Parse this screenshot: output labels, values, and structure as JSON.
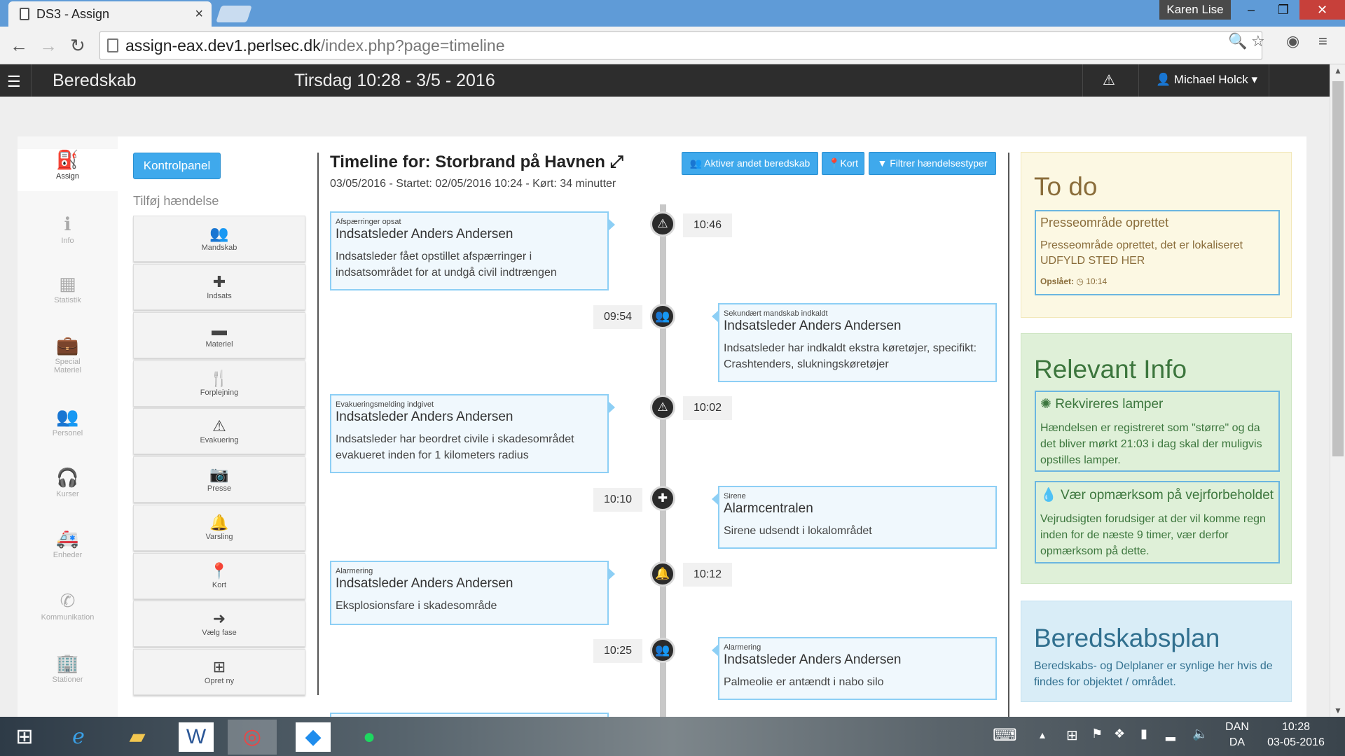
{
  "browser": {
    "tab_title": "DS3 - Assign",
    "tab_close": "×",
    "profile_name": "Karen Lise",
    "url_host": "assign-eax.dev1.perlsec.dk",
    "url_path": "/index.php?page=timeline",
    "win_min": "–",
    "win_max": "❐",
    "win_close": "✕"
  },
  "header": {
    "brand": "Beredskab",
    "datetime": "Tirsdag 10:28 - 3/5 - 2016",
    "user": "Michael Holck"
  },
  "leftnav": [
    {
      "icon": "fire-extinguisher-icon",
      "glyph": "⛽",
      "label": "Assign"
    },
    {
      "icon": "info-icon",
      "glyph": "ℹ",
      "label": "Info"
    },
    {
      "icon": "calendar-icon",
      "glyph": "▦",
      "label": "Statistik"
    },
    {
      "icon": "briefcase-icon",
      "glyph": "💼",
      "label": "Special\nMateriel"
    },
    {
      "icon": "users-icon",
      "glyph": "👥",
      "label": "Personel"
    },
    {
      "icon": "headphones-icon",
      "glyph": "🎧",
      "label": "Kurser"
    },
    {
      "icon": "ambulance-icon",
      "glyph": "🚑",
      "label": "Enheder"
    },
    {
      "icon": "phone-icon",
      "glyph": "✆",
      "label": "Kommunikation"
    },
    {
      "icon": "building-icon",
      "glyph": "🏢",
      "label": "Stationer"
    }
  ],
  "sidebar": {
    "kontrol_label": "Kontrolpanel",
    "add_event_label": "Tilføj hændelse",
    "buttons": [
      {
        "icon": "users-icon",
        "glyph": "👥",
        "label": "Mandskab"
      },
      {
        "icon": "medkit-icon",
        "glyph": "✚",
        "label": "Indsats"
      },
      {
        "icon": "archive-icon",
        "glyph": "▬",
        "label": "Materiel"
      },
      {
        "icon": "cutlery-icon",
        "glyph": "🍴",
        "label": "Forplejning"
      },
      {
        "icon": "warning-icon",
        "glyph": "⚠",
        "label": "Evakuering"
      },
      {
        "icon": "camera-icon",
        "glyph": "📷",
        "label": "Presse"
      },
      {
        "icon": "bell-icon",
        "glyph": "🔔",
        "label": "Varsling"
      },
      {
        "icon": "map-marker-icon",
        "glyph": "📍",
        "label": "Kort"
      },
      {
        "icon": "arrow-circle-icon",
        "glyph": "➜",
        "label": "Vælg fase"
      },
      {
        "icon": "plus-square-icon",
        "glyph": "⊞",
        "label": "Opret ny"
      }
    ]
  },
  "timeline": {
    "title": "Timeline for: Storbrand på Havnen",
    "subtitle": "03/05/2016 - Startet: 02/05/2016 10:24 - Kørt: 34 minutter",
    "btn_activate": "Aktiver andet beredskab",
    "btn_map": "Kort",
    "btn_filter": "Filtrer hændelsestyper",
    "events": [
      {
        "side": "left",
        "time": "10:46",
        "icon": "warning-icon",
        "glyph": "⚠",
        "category": "Afspærringer opsat",
        "who": "Indsatsleder Anders Andersen",
        "desc": "Indsatsleder fået opstillet afspærringer i indsatsområdet for at undgå civil indtrængen"
      },
      {
        "side": "right",
        "time": "09:54",
        "icon": "users-icon",
        "glyph": "👥",
        "category": "Sekundært mandskab indkaldt",
        "who": "Indsatsleder Anders Andersen",
        "desc": "Indsatsleder har indkaldt ekstra køretøjer, specifikt: Crashtenders, slukningskøretøjer"
      },
      {
        "side": "left",
        "time": "10:02",
        "icon": "warning-icon",
        "glyph": "⚠",
        "category": "Evakueringsmelding indgivet",
        "who": "Indsatsleder Anders Andersen",
        "desc": "Indsatsleder har beordret civile i skadesområdet evakueret inden for 1 kilometers radius"
      },
      {
        "side": "right",
        "time": "10:10",
        "icon": "ambulance-icon",
        "glyph": "✚",
        "category": "Sirene",
        "who": "Alarmcentralen",
        "desc": "Sirene udsendt i lokalområdet"
      },
      {
        "side": "left",
        "time": "10:12",
        "icon": "bell-icon",
        "glyph": "🔔",
        "category": "Alarmering",
        "who": "Indsatsleder Anders Andersen",
        "desc": "Eksplosionsfare i skadesområde"
      },
      {
        "side": "right",
        "time": "10:25",
        "icon": "users-icon",
        "glyph": "👥",
        "category": "Alarmering",
        "who": "Indsatsleder Anders Andersen",
        "desc": "Palmeolie er antændt i nabo silo"
      }
    ]
  },
  "todo": {
    "title": "To do",
    "item_title": "Presseområde oprettet",
    "item_desc": "Presseområde oprettet, det er lokaliseret UDFYLD STED HER",
    "item_meta_label": "Opslået:",
    "item_meta_time": "10:14"
  },
  "relevant": {
    "title": "Relevant Info",
    "items": [
      {
        "icon": "gear-icon",
        "glyph": "✺",
        "title": "Rekvireres lamper",
        "desc": "Hændelsen er registreret som \"større\" og da det bliver mørkt 21:03 i dag skal der muligvis opstilles lamper."
      },
      {
        "icon": "drop-icon",
        "glyph": "💧",
        "title": "Vær opmærksom på vejrforbeholdet",
        "desc": "Vejrudsigten forudsiger at der vil komme regn inden for de næste 9 timer, vær derfor opmærksom på dette."
      }
    ]
  },
  "plan": {
    "title": "Beredskabsplan",
    "desc": "Beredskabs- og Delplaner er synlige her hvis de findes for objektet / området."
  },
  "taskbar": {
    "lang_top": "DAN",
    "lang_bottom": "DA",
    "time": "10:28",
    "date": "03-05-2016"
  }
}
